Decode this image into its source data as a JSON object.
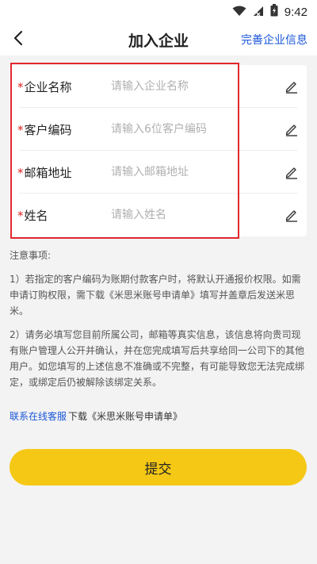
{
  "status_bar": {
    "time": "9:42"
  },
  "nav": {
    "title": "加入企业",
    "action": "完善企业信息"
  },
  "form": {
    "required_mark": "*",
    "fields": [
      {
        "label": "企业名称",
        "placeholder": "请输入企业名称",
        "value": ""
      },
      {
        "label": "客户编码",
        "placeholder": "请输入6位客户编码",
        "value": ""
      },
      {
        "label": "邮箱地址",
        "placeholder": "请输入邮箱地址",
        "value": ""
      },
      {
        "label": "姓名",
        "placeholder": "请输入姓名",
        "value": ""
      }
    ]
  },
  "notes": {
    "heading": "注意事项:",
    "item1": "1）若指定的客户编码为账期付款客户时，将默认开通报价权限。如需申请订购权限，需下载《米思米账号申请单》填写并盖章后发送米思米。",
    "item2": "2）请务必填写您目前所属公司，邮箱等真实信息，该信息将向贵司现有账户管理人公开并确认，并在您完成填写后共享给同一公司下的其他用户。如您填写的上述信息不准确或不完整，有可能导致您无法完成绑定，或绑定后仍被解除该绑定关系。"
  },
  "links": {
    "service": "联系在线客服",
    "download": "下载《米思米账号申请单》"
  },
  "submit_label": "提交",
  "colors": {
    "accent_blue": "#1a56d8",
    "submit_yellow": "#f5c816",
    "required_red": "#e02020",
    "highlight_red": "#e3282f"
  }
}
